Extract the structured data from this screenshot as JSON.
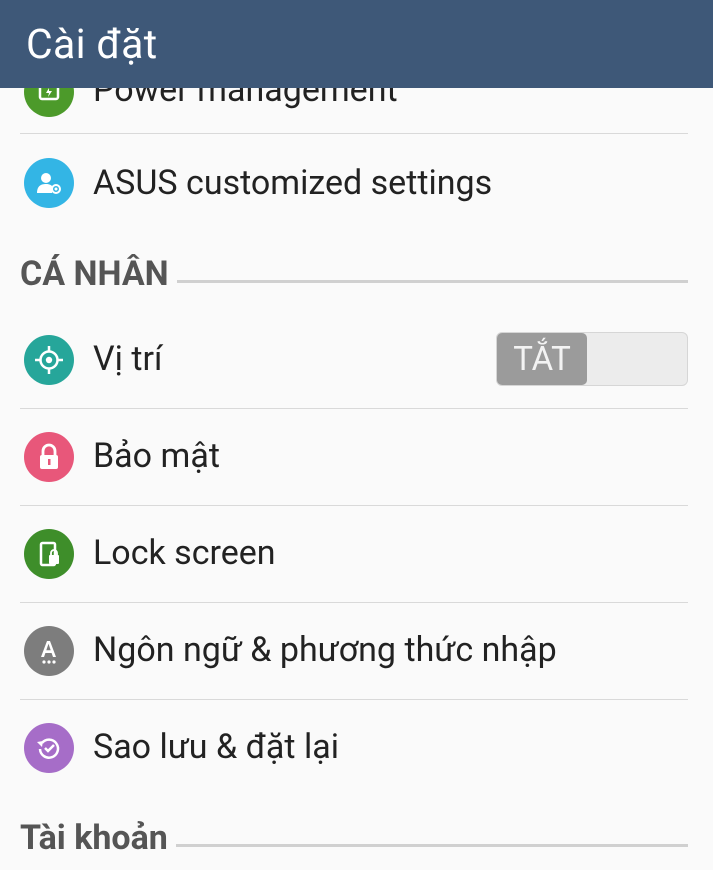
{
  "app_bar": {
    "title": "Cài đặt"
  },
  "items": {
    "power_management": {
      "label": "Power management",
      "icon": "power-icon",
      "color": "#4c9a2a"
    },
    "asus_customized": {
      "label": "ASUS customized settings",
      "icon": "user-gear-icon",
      "color": "#33b5e5"
    },
    "location": {
      "label": "Vị trí",
      "icon": "location-target-icon",
      "color": "#26a69a",
      "toggle_label": "TẮT",
      "toggle_on": false
    },
    "security": {
      "label": "Bảo mật",
      "icon": "lock-icon",
      "color": "#e8577a"
    },
    "lock_screen": {
      "label": "Lock screen",
      "icon": "lock-screen-icon",
      "color": "#3e8e2a"
    },
    "language_input": {
      "label": "Ngôn ngữ & phương thức nhập",
      "icon": "language-icon",
      "color": "#7d7d7d"
    },
    "backup_reset": {
      "label": "Sao lưu & đặt lại",
      "icon": "backup-restore-icon",
      "color": "#a66dc8"
    }
  },
  "sections": {
    "personal": {
      "title": "CÁ NHÂN"
    },
    "accounts": {
      "title": "Tài khoản"
    }
  }
}
